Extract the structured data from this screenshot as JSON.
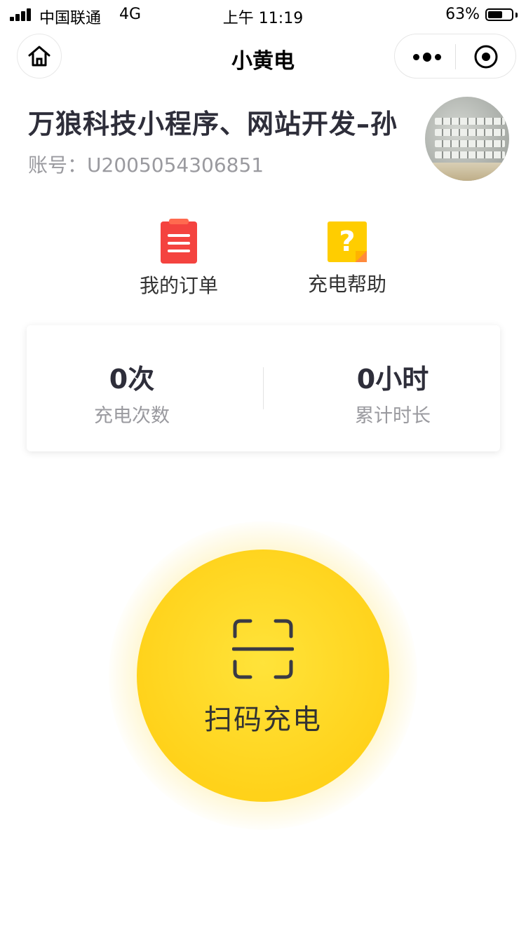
{
  "status_bar": {
    "carrier": "中国联通",
    "network": "4G",
    "time": "上午 11:19",
    "battery_percent": "63%",
    "battery_level": 0.63
  },
  "nav": {
    "title": "小黄电",
    "home_icon": "home-icon",
    "more_icon": "more-dots-icon",
    "close_icon": "target-close-icon"
  },
  "profile": {
    "name": "万狼科技小程序、网站开发–孙",
    "account_label": "账号：",
    "account_id": "U2005054306851"
  },
  "shortcuts": [
    {
      "label": "我的订单",
      "icon": "order-list-icon",
      "color": "#f4433f"
    },
    {
      "label": "充电帮助",
      "icon": "help-question-icon",
      "color": "#ffcd00"
    }
  ],
  "stats": [
    {
      "value": "0次",
      "label": "充电次数"
    },
    {
      "value": "0小时",
      "label": "累计时长"
    }
  ],
  "scan": {
    "label": "扫码充电",
    "icon": "scan-icon",
    "color": "#ffd21a"
  }
}
